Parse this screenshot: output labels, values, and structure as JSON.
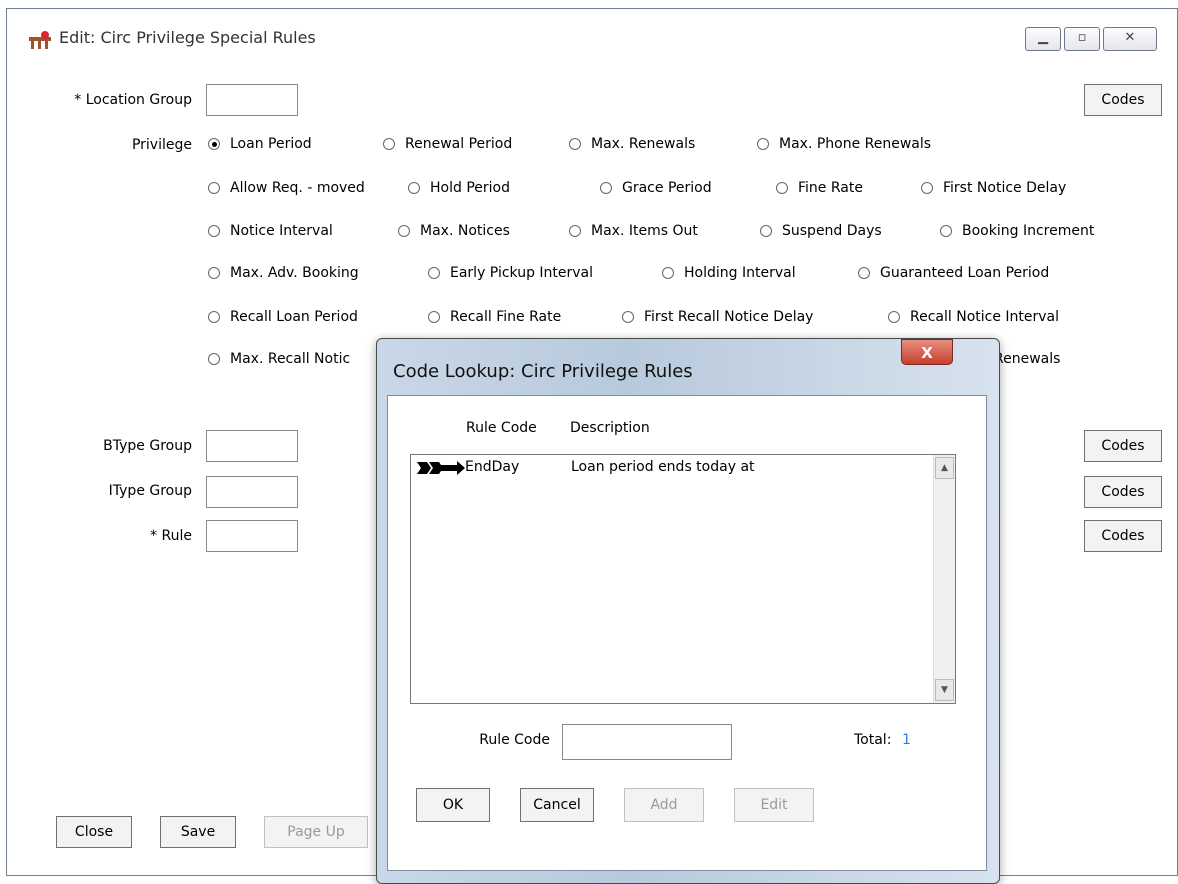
{
  "window": {
    "title": "Edit: Circ Privilege Special Rules"
  },
  "form": {
    "location_group": {
      "label": "* Location Group",
      "value": ""
    },
    "codes_label": "Codes",
    "privilege_label": "Privilege",
    "privilege_options": [
      "Loan Period",
      "Renewal Period",
      "Max. Renewals",
      "Max. Phone Renewals",
      "Allow Req. - moved",
      "Hold Period",
      "Grace Period",
      "Fine Rate",
      "First Notice Delay",
      "Notice Interval",
      "Max. Notices",
      "Max. Items Out",
      "Suspend Days",
      "Booking Increment",
      "Max. Adv. Booking",
      "Early Pickup Interval",
      "Holding Interval",
      "Guaranteed Loan Period",
      "Recall Loan Period",
      "Recall Fine Rate",
      "First Recall Notice Delay",
      "Recall Notice Interval",
      "Max. Recall Notic",
      "Renewals"
    ],
    "selected_privilege": "Loan Period",
    "btype_group": {
      "label": "BType Group",
      "value": ""
    },
    "itype_group": {
      "label": "IType Group",
      "value": ""
    },
    "rule": {
      "label": "* Rule",
      "value": ""
    }
  },
  "footer": {
    "close_label": "Close",
    "save_label": "Save",
    "page_up_label": "Page Up"
  },
  "dialog": {
    "title": "Code Lookup: Circ Privilege Rules",
    "close_glyph": "X",
    "columns": [
      "Rule Code",
      "Description"
    ],
    "rows": [
      {
        "code": "EndDay",
        "description": "Loan period ends today at"
      }
    ],
    "rule_code_label": "Rule Code",
    "rule_code_value": "",
    "total_label": "Total:",
    "total_value": "1",
    "buttons": {
      "ok": "OK",
      "cancel": "Cancel",
      "add": "Add",
      "edit": "Edit"
    }
  }
}
